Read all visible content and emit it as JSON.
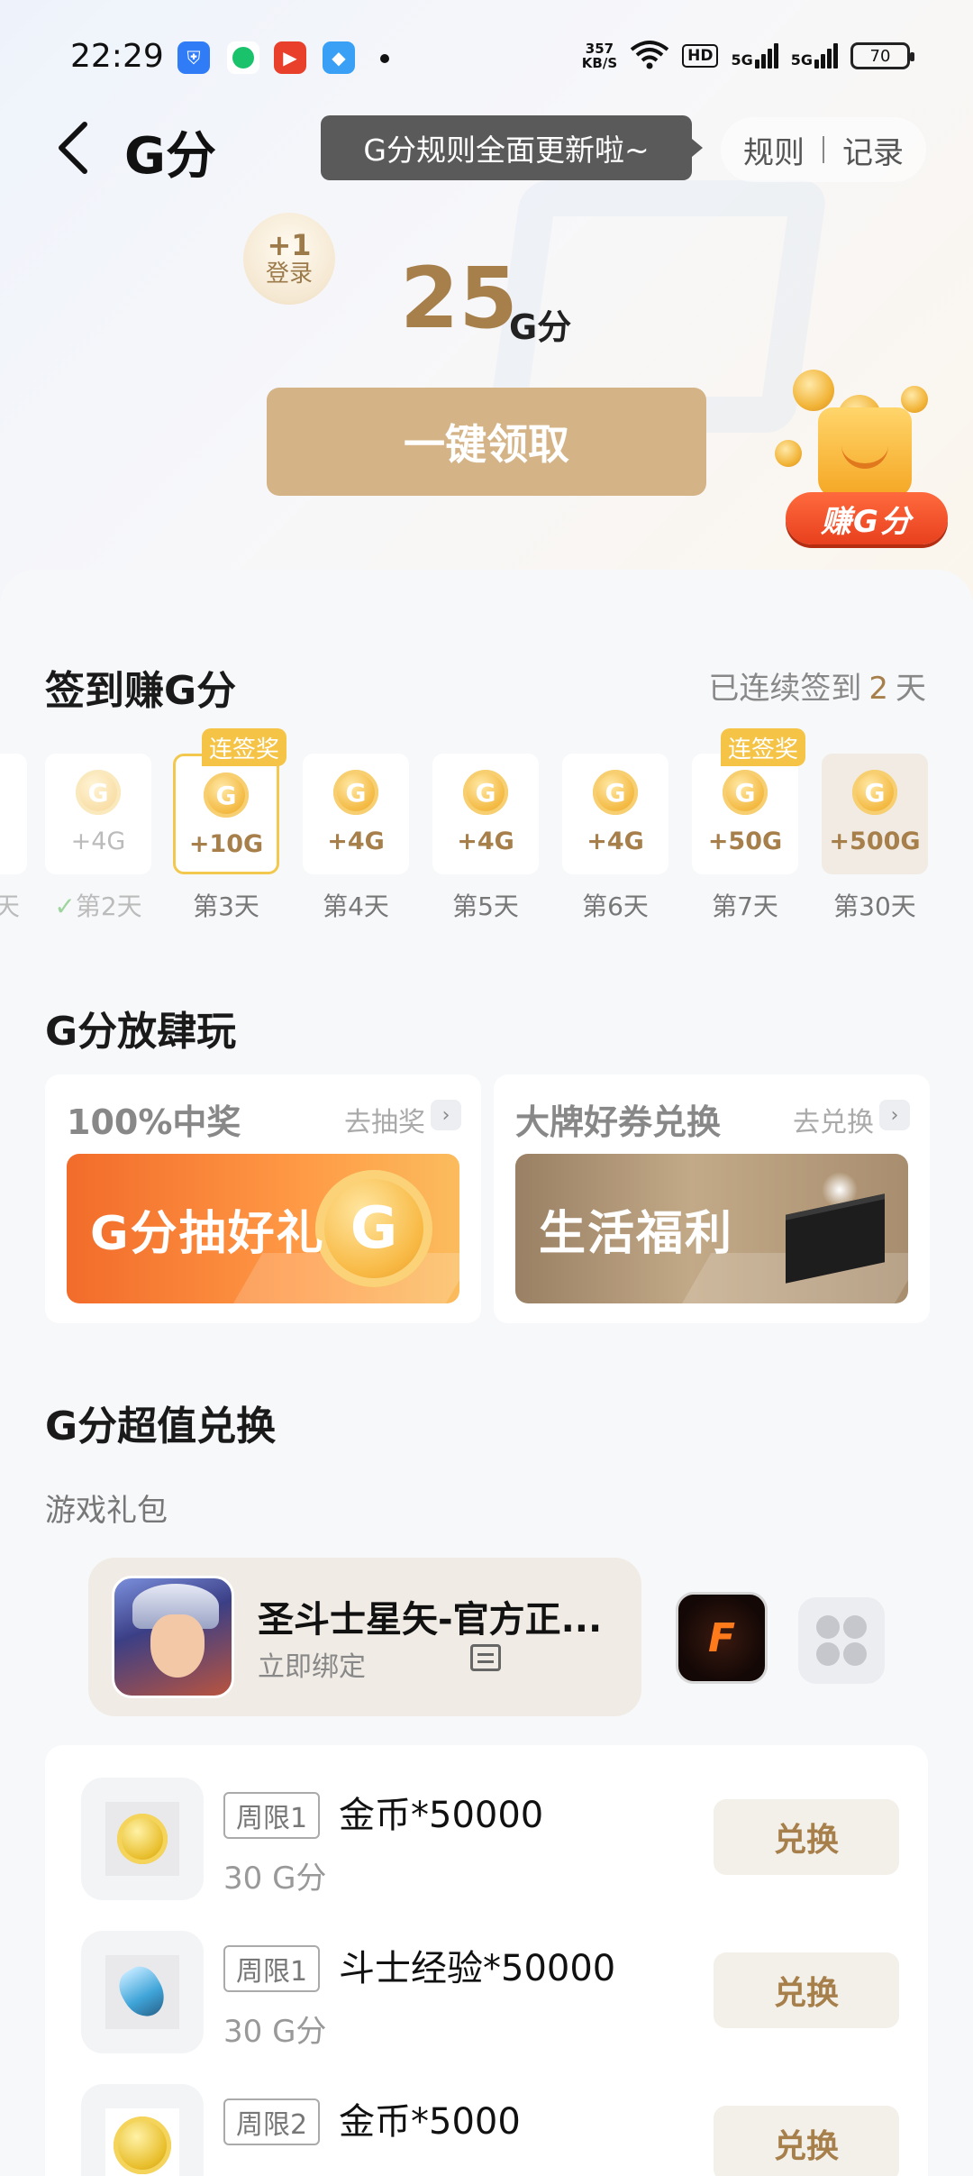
{
  "status_bar": {
    "time": "22:29",
    "net_speed_value": "357",
    "net_speed_unit": "KB/S",
    "hd": "HD",
    "signal1": "5G",
    "signal2": "5G",
    "battery": "70"
  },
  "header": {
    "title": "G分",
    "tooltip": "G分规则全面更新啦~",
    "rules_link": "规则",
    "records_link": "记录"
  },
  "points": {
    "login_bonus": "+1",
    "login_label": "登录",
    "value": "25",
    "unit": "G分",
    "claim_button": "一键领取",
    "earn_badge": "赚G分"
  },
  "checkin": {
    "title": "签到赚G分",
    "streak_prefix": "已连续签到",
    "streak_days": "2",
    "streak_suffix": "天",
    "edge_label": "天",
    "coin_glyph": "G",
    "days": [
      {
        "amount": "+4G",
        "label": "第2天",
        "check": "✓"
      },
      {
        "amount": "+10G",
        "label": "第3天",
        "tag": "连签奖"
      },
      {
        "amount": "+4G",
        "label": "第4天"
      },
      {
        "amount": "+4G",
        "label": "第5天"
      },
      {
        "amount": "+4G",
        "label": "第6天"
      },
      {
        "amount": "+50G",
        "label": "第7天",
        "tag": "连签奖"
      },
      {
        "amount": "+500G",
        "label": "第30天"
      }
    ]
  },
  "play": {
    "title": "G分放肆玩",
    "cards": [
      {
        "title": "100%中奖",
        "link": "去抽奖",
        "banner": "G分抽好礼"
      },
      {
        "title": "大牌好券兑换",
        "link": "去兑换",
        "banner": "生活福利"
      }
    ]
  },
  "exchange": {
    "title": "G分超值兑换",
    "subtitle": "游戏礼包",
    "selected_game": {
      "name": "圣斗士星矢-官方正...",
      "bind": "立即绑定"
    },
    "other_game_icon_text": "F",
    "items": [
      {
        "tag": "周限1",
        "name": "金币*50000",
        "cost": "30 G分",
        "button": "兑换"
      },
      {
        "tag": "周限1",
        "name": "斗士经验*50000",
        "cost": "30 G分",
        "button": "兑换"
      },
      {
        "tag": "周限2",
        "name": "金币*5000",
        "cost": "",
        "button": "兑换"
      }
    ]
  }
}
